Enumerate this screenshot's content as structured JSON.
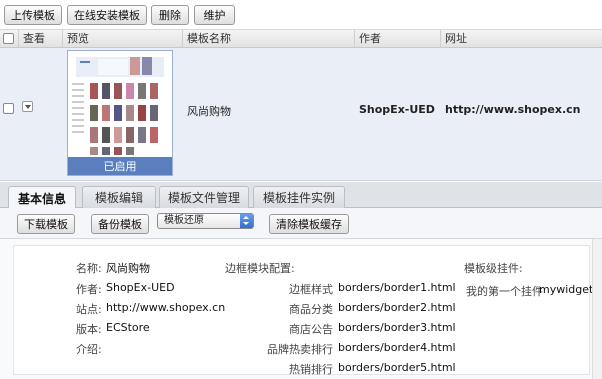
{
  "toolbar": {
    "upload_label": "上传模板",
    "online_install_label": "在线安装模板",
    "delete_label": "删除",
    "maintain_label": "维护"
  },
  "table": {
    "headers": [
      "查看",
      "预览",
      "模板名称",
      "作者",
      "网址"
    ],
    "row": {
      "name": "风尚购物",
      "author": "ShopEx-UED",
      "url": "http://www.shopex.cn",
      "status": "已启用"
    }
  },
  "tabs": [
    "基本信息",
    "模板编辑",
    "模板文件管理",
    "模板挂件实例"
  ],
  "subtoolbar": {
    "download_label": "下载模板",
    "backup_label": "备份模板",
    "restore_selected": "模板还原",
    "clear_cache_label": "清除模板缓存"
  },
  "basic": {
    "name_label": "名称:",
    "name_value": "风尚购物",
    "author_label": "作者:",
    "author_value": "ShopEx-UED",
    "site_label": "站点:",
    "site_value": "http://www.shopex.cn",
    "version_label": "版本:",
    "version_value": "ECStore",
    "intro_label": "介绍:"
  },
  "border": {
    "title": "边框模块配置:",
    "items": [
      {
        "label": "边框样式",
        "value": "borders/border1.html"
      },
      {
        "label": "商品分类",
        "value": "borders/border2.html"
      },
      {
        "label": "商店公告",
        "value": "borders/border3.html"
      },
      {
        "label": "品牌热卖排行",
        "value": "borders/border4.html"
      },
      {
        "label": "热销排行",
        "value": "borders/border5.html"
      }
    ]
  },
  "widgets": {
    "title": "模板级挂件:",
    "item_label": "我的第一个挂件",
    "item_value": "mywidget"
  },
  "colors": {
    "row_bg": "#e9eef7",
    "status_bar": "#5b7fbe",
    "select_arrow": "#2f6bd0"
  }
}
